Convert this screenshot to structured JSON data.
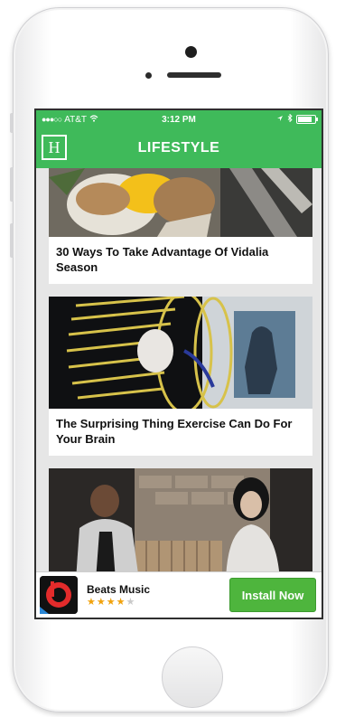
{
  "status_bar": {
    "carrier": "AT&T",
    "time": "3:12 PM"
  },
  "header": {
    "logo_letter": "H",
    "title": "LIFESTYLE"
  },
  "articles": [
    {
      "title": "30 Ways To Take Advantage Of Vidalia Season"
    },
    {
      "title": "The Surprising Thing Exercise Can Do For Your Brain"
    },
    {
      "title": ""
    }
  ],
  "ad": {
    "app_name": "Beats Music",
    "rating": 4,
    "rating_max": 5,
    "cta_label": "Install Now"
  },
  "colors": {
    "brand_green": "#3fba5a",
    "install_green": "#4eb53d",
    "star": "#f1a20c"
  }
}
